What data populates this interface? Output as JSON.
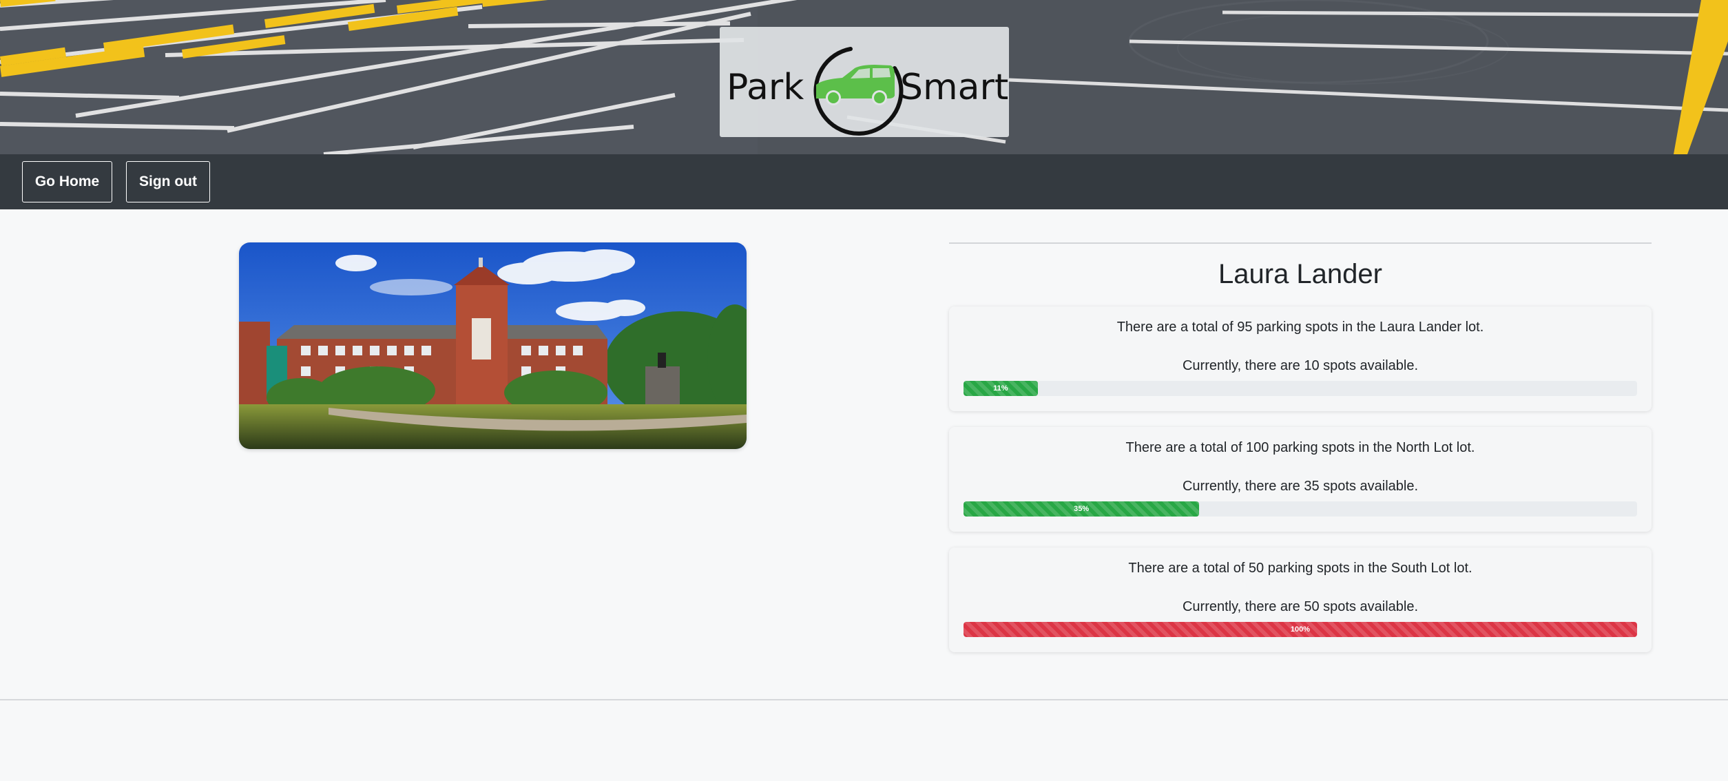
{
  "header": {
    "logo_text_left": "Park",
    "logo_text_right": "Smart",
    "logo_accent_color": "#5cbf4a"
  },
  "nav": {
    "home_label": "Go Home",
    "signout_label": "Sign out"
  },
  "lot": {
    "title": "Laura Lander"
  },
  "lots": [
    {
      "total_text": "There are a total of 95 parking spots in the Laura Lander lot.",
      "available_text": "Currently, there are 10 spots available.",
      "percent": 11,
      "percent_label": "11%",
      "color": "#28a745"
    },
    {
      "total_text": "There are a total of 100 parking spots in the North Lot lot.",
      "available_text": "Currently, there are 35 spots available.",
      "percent": 35,
      "percent_label": "35%",
      "color": "#28a745"
    },
    {
      "total_text": "There are a total of 50 parking spots in the South Lot lot.",
      "available_text": "Currently, there are 50 spots available.",
      "percent": 100,
      "percent_label": "100%",
      "color": "#dc3545"
    }
  ]
}
